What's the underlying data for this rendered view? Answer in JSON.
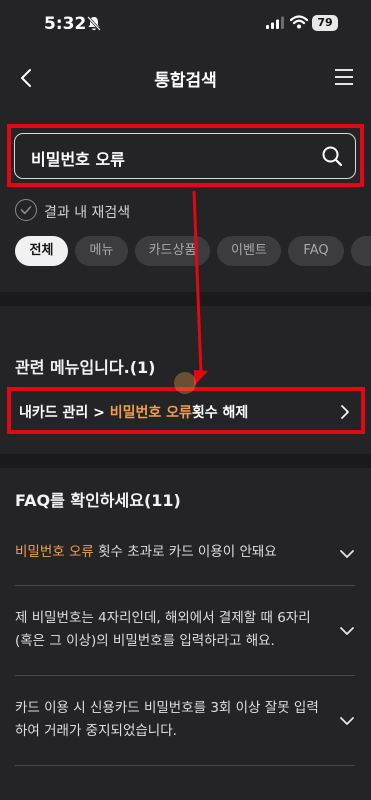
{
  "status": {
    "time": "5:32",
    "battery": "79"
  },
  "header": {
    "title": "통합검색"
  },
  "search": {
    "query": "비밀번호 오류"
  },
  "research_label": "결과 내 재검색",
  "chips": [
    "전체",
    "메뉴",
    "카드상품",
    "이벤트",
    "FAQ"
  ],
  "menu_section": {
    "title": "관련 메뉴입니다.(1)",
    "item": {
      "prefix": "내카드 관리 > ",
      "highlight": "비밀번호 오류",
      "suffix": "횟수 해제"
    }
  },
  "faq_section": {
    "title": "FAQ를 확인하세요(11)",
    "items": [
      {
        "highlight": "비밀번호 오류",
        "text": " 횟수 초과로 카드 이용이 안돼요"
      },
      {
        "highlight": "",
        "text": "제 비밀번호는 4자리인데, 해외에서 결제할 때 6자리(혹은 그 이상)의 비밀번호를 입력하라고 해요."
      },
      {
        "highlight": "",
        "text": "카드 이용 시 신용카드 비밀번호를 3회 이상 잘못 입력하여 거래가 중지되었습니다."
      }
    ]
  },
  "colors": {
    "accent_orange": "#f0a04b",
    "highlight_red": "#e30613",
    "background": "#242426"
  }
}
